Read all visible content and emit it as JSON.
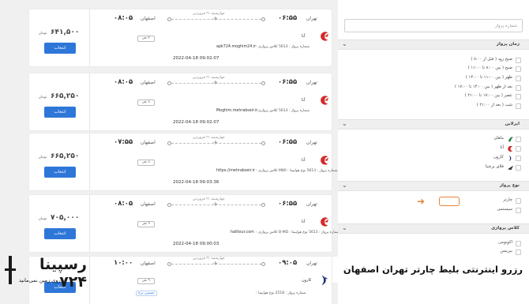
{
  "filters": {
    "search_placeholder": "شماره پرواز",
    "sections": [
      {
        "title": "زمان پرواز",
        "options": [
          "صبح زود ( قبل از ۸:۰۰ )",
          "صبح ( بین ۸:۰۰ تا ۱۱:۰۰ )",
          "ظهر ( بین ۱۱:۰۰ تا ۱۴:۰۰ )",
          "بعد از ظهر ( بین ۱۴:۰۰ تا ۱۷:۰۰ )",
          "عصر ( بین ۱۷:۰۰ تا ۲۱:۰۰ )",
          "شب ( بعد از ۲۱:۰۰ )"
        ]
      },
      {
        "title": "ایرلاین",
        "options": [
          "ماهان",
          "آتا",
          "کارون",
          "فلای پرشیا"
        ]
      },
      {
        "title": "نوع پرواز",
        "options": [
          "چارتر",
          "سیستمی"
        ]
      },
      {
        "title": "کلاس پروازی",
        "options": [
          "اکونومی",
          "بیزینس"
        ]
      }
    ]
  },
  "flights": [
    {
      "price": "۶۴۱,۵۰۰",
      "currency": "تومان",
      "select_label": "انتخاب",
      "dest_city": "اصفهان",
      "dest_time": "۰۸:۰۵",
      "origin_city": "تهران",
      "origin_time": "۰۶:۵۵",
      "date": "چهارشنبه ۳۱ فروردین",
      "seats": "۴ نفر",
      "airline": "آتا",
      "flight_info": "شماره پرواز : 5613 کلاس پروازی :",
      "site": "apk724.moghim24.ir",
      "timestamp": "2022-04-18 09:02:07"
    },
    {
      "price": "۶۶۵,۲۵۰",
      "currency": "تومان",
      "select_label": "انتخاب",
      "dest_city": "اصفهان",
      "dest_time": "۰۸:۰۵",
      "origin_city": "تهران",
      "origin_time": "۰۶:۵۵",
      "date": "چهارشنبه ۳۱ فروردین",
      "seats": "۸ نفر",
      "airline": "آتا",
      "flight_info": "شماره پرواز : 5613 کلاس پروازی :",
      "site": "Moghim.mehrabseir.ir",
      "timestamp": "2022-04-18 09:02:07"
    },
    {
      "price": "۶۶۵,۲۵۰",
      "currency": "تومان",
      "select_label": "انتخاب",
      "dest_city": "اصفهان",
      "dest_time": "۰۷:۵۵",
      "origin_city": "تهران",
      "origin_time": "۰۶:۵۵",
      "date": "چهارشنبه ۳۱ فروردین",
      "seats": "۸ نفر",
      "airline": "آتا",
      "flight_info": "شماره پرواز : 5613 نوع هواپیما : M80 کلاس پروازی :",
      "site": "https://mehrabseir.ir",
      "timestamp": "2022-04-18 09:03:36"
    },
    {
      "price": "۷۰۵,۰۰۰",
      "currency": "تومان",
      "select_label": "انتخاب",
      "dest_city": "اصفهان",
      "dest_time": "۰۸:۰۵",
      "origin_city": "تهران",
      "origin_time": "۰۶:۵۵",
      "date": "چهارشنبه ۳۱ فروردین",
      "seats": "۹ نفر",
      "airline": "آتا",
      "flight_info": "شماره پرواز : 5613 نوع هواپیما : B-MD کلاس پروازی :",
      "site": "halltour.com",
      "timestamp": "2022-04-18 09:00:03"
    },
    {
      "price": "",
      "currency": "",
      "select_label": "انتخاب",
      "dest_city": "اصفهان",
      "dest_time": "۱۰:۰۰",
      "origin_city": "تهران",
      "origin_time": "۰۹:۰۵",
      "date": "چهارشنبه ۳۱ فروردین",
      "seats": "۹ نفر",
      "airline": "کارون",
      "flight_info": "شماره پرواز : 2518 نوع هواپیما :",
      "site": "",
      "timestamp": "",
      "badge": "تضمین نرخ"
    }
  ],
  "watermark": {
    "brand": "رسپینا ۷۲۴",
    "tagline": "روی زمین نمی‌مانید"
  },
  "caption": "رزرو اینترنتی بلیط چارتر تهران اصفهان",
  "colors": {
    "accent_blue": "#2e77d8",
    "highlight_orange": "#e8823b",
    "ata_red": "#d32b2b",
    "mahan_red": "#c42a2a",
    "karun_navy": "#1b2f6b"
  }
}
